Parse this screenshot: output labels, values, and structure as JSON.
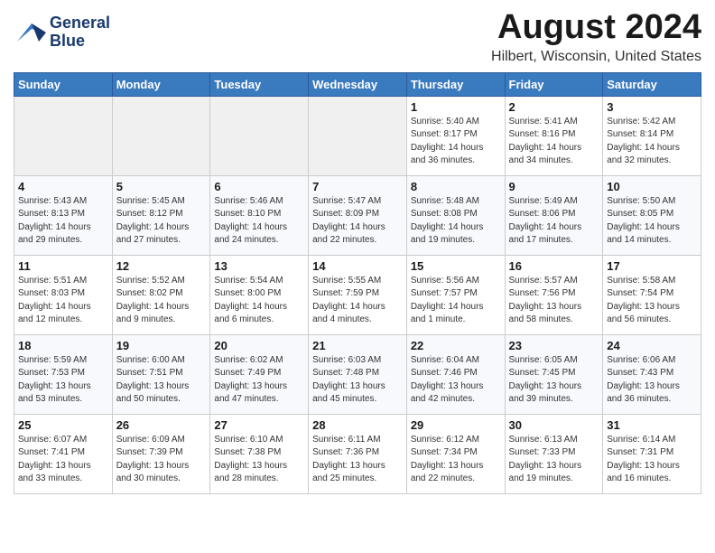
{
  "header": {
    "logo_line1": "General",
    "logo_line2": "Blue",
    "month": "August 2024",
    "location": "Hilbert, Wisconsin, United States"
  },
  "weekdays": [
    "Sunday",
    "Monday",
    "Tuesday",
    "Wednesday",
    "Thursday",
    "Friday",
    "Saturday"
  ],
  "weeks": [
    [
      {
        "day": "",
        "info": ""
      },
      {
        "day": "",
        "info": ""
      },
      {
        "day": "",
        "info": ""
      },
      {
        "day": "",
        "info": ""
      },
      {
        "day": "1",
        "info": "Sunrise: 5:40 AM\nSunset: 8:17 PM\nDaylight: 14 hours\nand 36 minutes."
      },
      {
        "day": "2",
        "info": "Sunrise: 5:41 AM\nSunset: 8:16 PM\nDaylight: 14 hours\nand 34 minutes."
      },
      {
        "day": "3",
        "info": "Sunrise: 5:42 AM\nSunset: 8:14 PM\nDaylight: 14 hours\nand 32 minutes."
      }
    ],
    [
      {
        "day": "4",
        "info": "Sunrise: 5:43 AM\nSunset: 8:13 PM\nDaylight: 14 hours\nand 29 minutes."
      },
      {
        "day": "5",
        "info": "Sunrise: 5:45 AM\nSunset: 8:12 PM\nDaylight: 14 hours\nand 27 minutes."
      },
      {
        "day": "6",
        "info": "Sunrise: 5:46 AM\nSunset: 8:10 PM\nDaylight: 14 hours\nand 24 minutes."
      },
      {
        "day": "7",
        "info": "Sunrise: 5:47 AM\nSunset: 8:09 PM\nDaylight: 14 hours\nand 22 minutes."
      },
      {
        "day": "8",
        "info": "Sunrise: 5:48 AM\nSunset: 8:08 PM\nDaylight: 14 hours\nand 19 minutes."
      },
      {
        "day": "9",
        "info": "Sunrise: 5:49 AM\nSunset: 8:06 PM\nDaylight: 14 hours\nand 17 minutes."
      },
      {
        "day": "10",
        "info": "Sunrise: 5:50 AM\nSunset: 8:05 PM\nDaylight: 14 hours\nand 14 minutes."
      }
    ],
    [
      {
        "day": "11",
        "info": "Sunrise: 5:51 AM\nSunset: 8:03 PM\nDaylight: 14 hours\nand 12 minutes."
      },
      {
        "day": "12",
        "info": "Sunrise: 5:52 AM\nSunset: 8:02 PM\nDaylight: 14 hours\nand 9 minutes."
      },
      {
        "day": "13",
        "info": "Sunrise: 5:54 AM\nSunset: 8:00 PM\nDaylight: 14 hours\nand 6 minutes."
      },
      {
        "day": "14",
        "info": "Sunrise: 5:55 AM\nSunset: 7:59 PM\nDaylight: 14 hours\nand 4 minutes."
      },
      {
        "day": "15",
        "info": "Sunrise: 5:56 AM\nSunset: 7:57 PM\nDaylight: 14 hours\nand 1 minute."
      },
      {
        "day": "16",
        "info": "Sunrise: 5:57 AM\nSunset: 7:56 PM\nDaylight: 13 hours\nand 58 minutes."
      },
      {
        "day": "17",
        "info": "Sunrise: 5:58 AM\nSunset: 7:54 PM\nDaylight: 13 hours\nand 56 minutes."
      }
    ],
    [
      {
        "day": "18",
        "info": "Sunrise: 5:59 AM\nSunset: 7:53 PM\nDaylight: 13 hours\nand 53 minutes."
      },
      {
        "day": "19",
        "info": "Sunrise: 6:00 AM\nSunset: 7:51 PM\nDaylight: 13 hours\nand 50 minutes."
      },
      {
        "day": "20",
        "info": "Sunrise: 6:02 AM\nSunset: 7:49 PM\nDaylight: 13 hours\nand 47 minutes."
      },
      {
        "day": "21",
        "info": "Sunrise: 6:03 AM\nSunset: 7:48 PM\nDaylight: 13 hours\nand 45 minutes."
      },
      {
        "day": "22",
        "info": "Sunrise: 6:04 AM\nSunset: 7:46 PM\nDaylight: 13 hours\nand 42 minutes."
      },
      {
        "day": "23",
        "info": "Sunrise: 6:05 AM\nSunset: 7:45 PM\nDaylight: 13 hours\nand 39 minutes."
      },
      {
        "day": "24",
        "info": "Sunrise: 6:06 AM\nSunset: 7:43 PM\nDaylight: 13 hours\nand 36 minutes."
      }
    ],
    [
      {
        "day": "25",
        "info": "Sunrise: 6:07 AM\nSunset: 7:41 PM\nDaylight: 13 hours\nand 33 minutes."
      },
      {
        "day": "26",
        "info": "Sunrise: 6:09 AM\nSunset: 7:39 PM\nDaylight: 13 hours\nand 30 minutes."
      },
      {
        "day": "27",
        "info": "Sunrise: 6:10 AM\nSunset: 7:38 PM\nDaylight: 13 hours\nand 28 minutes."
      },
      {
        "day": "28",
        "info": "Sunrise: 6:11 AM\nSunset: 7:36 PM\nDaylight: 13 hours\nand 25 minutes."
      },
      {
        "day": "29",
        "info": "Sunrise: 6:12 AM\nSunset: 7:34 PM\nDaylight: 13 hours\nand 22 minutes."
      },
      {
        "day": "30",
        "info": "Sunrise: 6:13 AM\nSunset: 7:33 PM\nDaylight: 13 hours\nand 19 minutes."
      },
      {
        "day": "31",
        "info": "Sunrise: 6:14 AM\nSunset: 7:31 PM\nDaylight: 13 hours\nand 16 minutes."
      }
    ]
  ]
}
